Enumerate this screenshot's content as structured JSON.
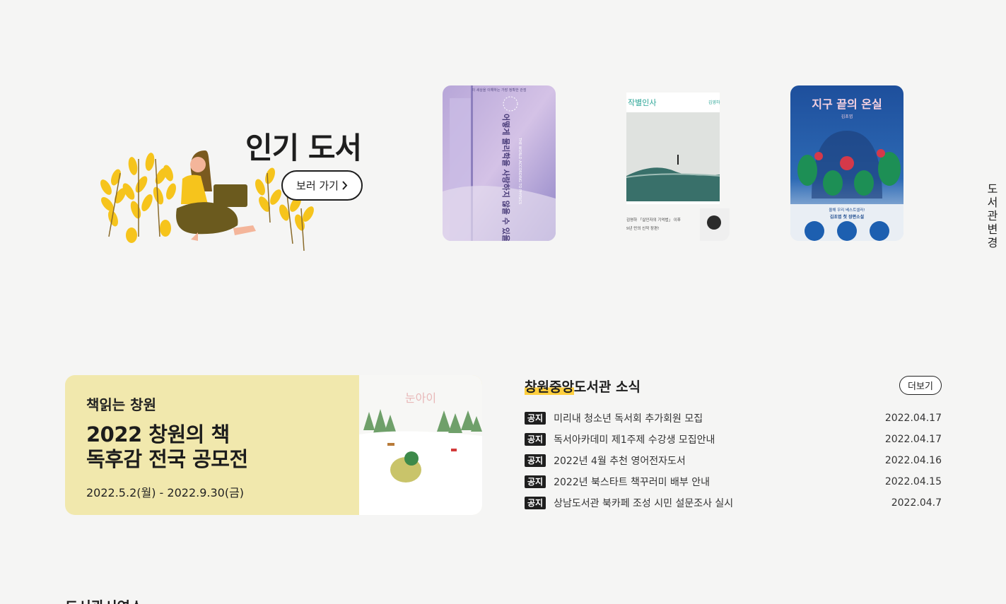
{
  "popular": {
    "title": "인기 도서",
    "view_button": "보러 가기",
    "books": [
      {
        "title": "어떻게 물리학을 사랑하지 않을 수 있을까?",
        "tagline": "이 세상을 이해하는 가장 정확한 관점",
        "english": "THE WORLD ACCORDING TO PHYSICS"
      },
      {
        "title": "작별인사",
        "author": "김영하",
        "caption_line1": "김영하 「살인자의 기억법」 이후",
        "caption_line2": "9년 만의 신작 장편!"
      },
      {
        "title": "지구 끝의 온실",
        "author": "김초엽",
        "band_line1": "올해 우리 베스트셀러!",
        "band_line2": "김초엽 첫 장편소설"
      }
    ]
  },
  "side": {
    "library_change": "도서관변경"
  },
  "banner": {
    "subtitle": "책읽는 창원",
    "title_line1": "2022 창원의 책",
    "title_line2": "독후감 전국 공모전",
    "date": "2022.5.2(월) - 2022.9.30(금)",
    "book_title": "눈아이"
  },
  "notices": {
    "title_highlight": "창원중앙",
    "title_rest": "도서관 소식",
    "more_label": "더보기",
    "items": [
      {
        "tag": "공지",
        "text": "미리내 청소년 독서회 추가회원 모집",
        "date": "2022.04.17"
      },
      {
        "tag": "공지",
        "text": "독서아카데미 제1주제 수강생 모집안내",
        "date": "2022.04.17"
      },
      {
        "tag": "공지",
        "text": "2022년 4월 추천 영어전자도서",
        "date": "2022.04.16"
      },
      {
        "tag": "공지",
        "text": "2022년 북스타트 책꾸러미 배부 안내",
        "date": "2022.04.15"
      },
      {
        "tag": "공지",
        "text": "상남도서관 북카페 조성 시민 설문조사 실시",
        "date": "2022.04.7"
      }
    ]
  },
  "next_section": {
    "title": "도서관시연소"
  }
}
